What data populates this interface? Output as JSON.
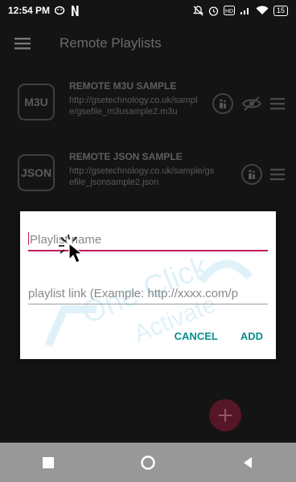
{
  "status_bar": {
    "time": "12:54 PM",
    "battery": "15"
  },
  "app_bar": {
    "title": "Remote Playlists"
  },
  "playlists": [
    {
      "badge": "M3U",
      "title": "REMOTE M3U SAMPLE",
      "url": "http://gsetechnology.co.uk/sample/gsefile_m3usample2.m3u"
    },
    {
      "badge": "JSON",
      "title": "REMOTE JSON SAMPLE",
      "url": "http://gsetechnology.co.uk/sample/gsefile_jsonsample2.json"
    }
  ],
  "dialog": {
    "name_placeholder": "Playlist name",
    "link_placeholder": "playlist link (Example: http://xxxx.com/p",
    "cancel": "CANCEL",
    "add": "ADD"
  },
  "colors": {
    "accent": "#c2185b",
    "action": "#0a8d8d",
    "background": "#141414"
  }
}
